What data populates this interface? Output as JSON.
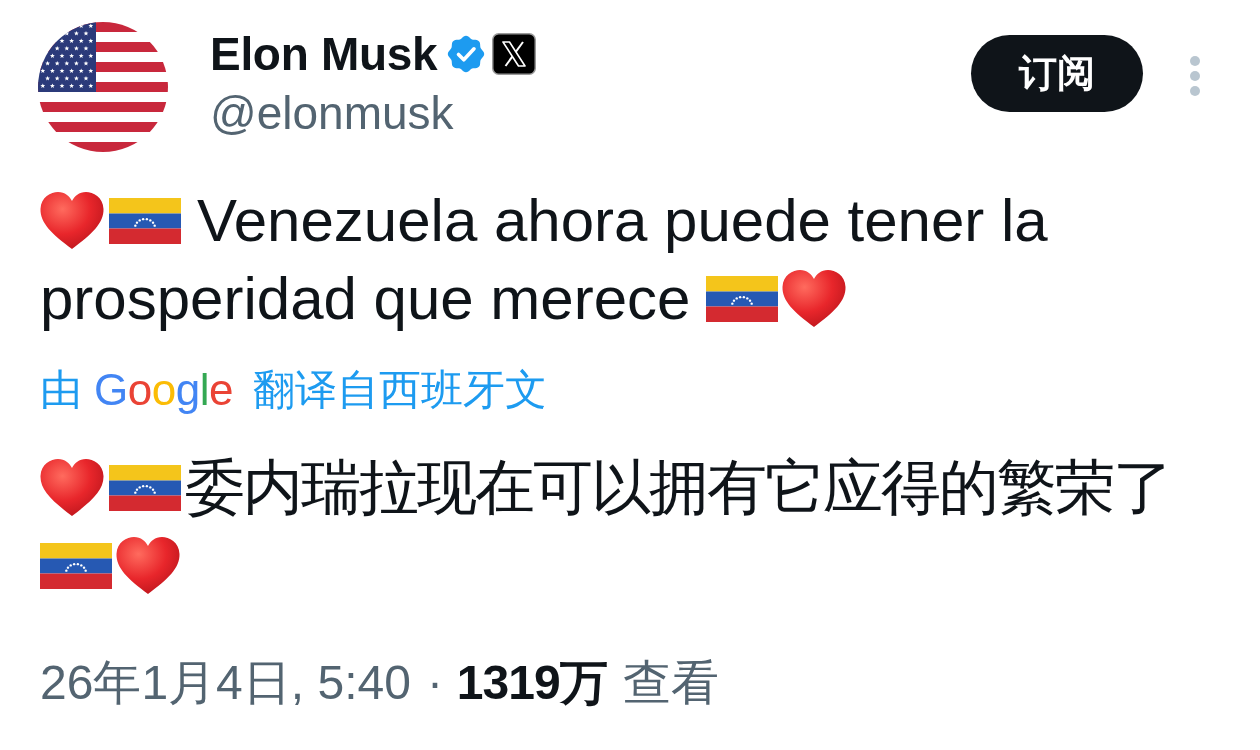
{
  "author": {
    "name": "Elon Musk",
    "handle": "@elonmusk",
    "verified": true
  },
  "subscribe_button": {
    "label": "订阅"
  },
  "post": {
    "text_lines": [
      "Venezuela ahora puede tener la",
      "prosperidad que merece"
    ],
    "translation_credit": {
      "prefix": "由",
      "provider": "Google",
      "suffix": "翻译自西班牙文"
    },
    "translated_lines": [
      "委内瑞拉现在可以拥有它应得的繁荣了"
    ]
  },
  "meta": {
    "timestamp": "26年1月4日, 5:40",
    "separator": "·",
    "views_count": "1319万",
    "views_label": "查看"
  }
}
